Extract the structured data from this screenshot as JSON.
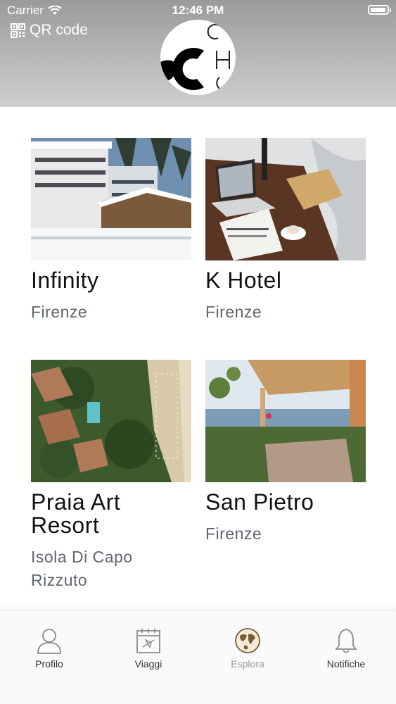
{
  "status_bar": {
    "carrier": "Carrier",
    "time": "12:46 PM",
    "battery_level": 0.95
  },
  "header": {
    "qr_label": "QR code"
  },
  "hotels": [
    {
      "name": "Infinity",
      "city": "Firenze",
      "image": "snowy-hotel"
    },
    {
      "name": "K Hotel",
      "city": "Firenze",
      "image": "desk-laptop"
    },
    {
      "name": "Praia Art Resort",
      "city": "Isola Di Capo Rizzuto",
      "image": "aerial-resort"
    },
    {
      "name": "San Pietro",
      "city": "Firenze",
      "image": "terrace-sea"
    }
  ],
  "tabbar": {
    "tabs": [
      {
        "label": "Profilo",
        "icon": "person-icon"
      },
      {
        "label": "Viaggi",
        "icon": "calendar-plane-icon"
      },
      {
        "label": "Esplora",
        "icon": "globe-icon",
        "active": true
      },
      {
        "label": "Notifiche",
        "icon": "bell-icon"
      }
    ]
  },
  "colors": {
    "header_top": "#9a9a9a",
    "active_tab": "#9a9a9a",
    "title": "#111111",
    "city": "#5f6670"
  }
}
